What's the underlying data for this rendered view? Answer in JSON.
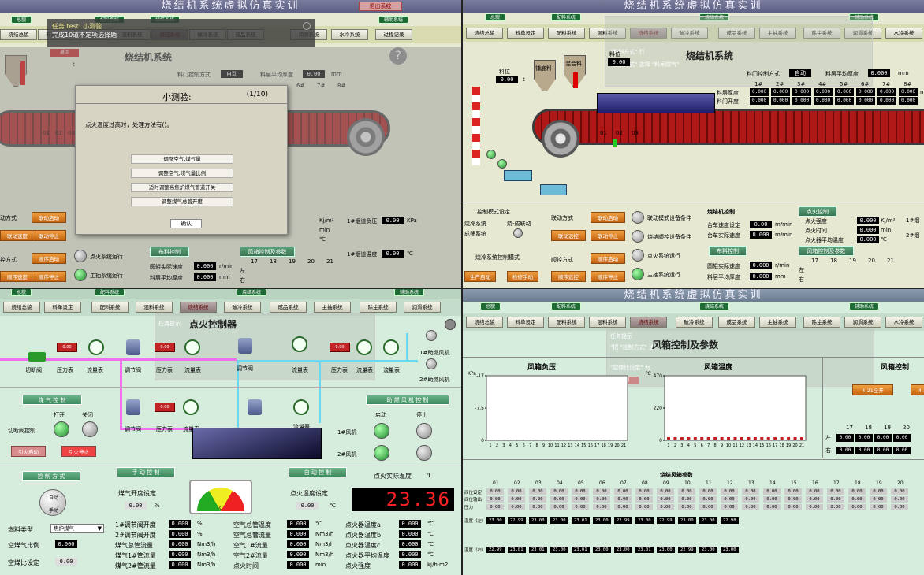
{
  "app_title": "烧结机系统虚拟仿真实训",
  "groups": {
    "total": "总貌",
    "batching": "配料系统",
    "sinter": "烧结系统",
    "aux": "辅助系统"
  },
  "nav": [
    "烧结总貌",
    "料单设定",
    "配料系统",
    "混料系统",
    "烧结系统",
    "破冷系统",
    "成品系统",
    "主抽系统",
    "除尘系统",
    "润滑系统",
    "水冷系统",
    "过程记录"
  ],
  "nav_q2": [
    "烧结总貌",
    "料单设定",
    "配料系统",
    "混料系统",
    "烧结系统",
    "破冷系统",
    "成品系统",
    "主抽系统",
    "除尘系统",
    "润滑系统",
    "水冷系统"
  ],
  "q1": {
    "exit": "退出系统",
    "task": {
      "line1": "任务 test: 小测验",
      "line2": "完成10道不定项选择题",
      "return": "返回"
    },
    "title": "烧结机系统",
    "ignition_mode": "料门控制方式",
    "mode_val": "自动",
    "thickness_label": "料层平均厚度",
    "thickness_val": "0.00",
    "thickness_unit": "mm",
    "cols": [
      "6#",
      "7#",
      "8#"
    ],
    "rows": [
      "0.00",
      "0.00",
      "0.00"
    ],
    "unit_pct": "%",
    "t_label": "t",
    "modal": {
      "title": "小测验:",
      "progress": "(1/10)",
      "question": "点火温度过高时，处理方法有()。",
      "options": [
        "调整空气,煤气量",
        "调整空气,煤气量比例",
        "适时调整高焦炉煤气管道开关",
        "调整煤气总管开度"
      ],
      "confirm": "确认"
    },
    "lbl_linkmode": "动方式",
    "lbl_manual": "控方式",
    "btn_link_start": "联动启动",
    "btn_link_stop": "联动停止",
    "btn_link_fast": "联动速度",
    "btn_seq_start": "顺序启动",
    "btn_seq_stop": "顺序停止",
    "btn_seq_fast": "顺序速度",
    "ignite_run": "点火系统运行",
    "main_run": "主抽系统运行",
    "cloth": "布料控制",
    "roller_speed": "圆辊实际速度",
    "layer_thick": "料层平均厚度",
    "rpm": "r/min",
    "mm": "mm",
    "fan_ctrl": "风箱控制及参数",
    "fan_cols": [
      "17",
      "18",
      "19",
      "20",
      "21"
    ],
    "left": "左",
    "right": "右",
    "kj": "Kj/m²",
    "min": "min",
    "deg": "℃",
    "smoke1": "1#烟道负压",
    "smoke2": "1#烟道温度",
    "kpa": "KPa",
    "zero": "0.00",
    "zero0": "0.000",
    "num_01": "01",
    "num_02": "02",
    "num_03": "03"
  },
  "q2": {
    "title": "烧结机系统",
    "task": {
      "line1": "料位",
      "line2": "\"整制方式\" 行",
      "line3": "\"组控方式\" 选择 \"料闸煤气\""
    },
    "hopper1": "铺底料",
    "hopper2": "混合料",
    "level": "料位",
    "t": "t",
    "ignite_ctrl": "料门控制方式",
    "auto": "自动",
    "avg_thick": "料层平均厚度",
    "mm": "mm",
    "cols": [
      "1#",
      "2#",
      "3#",
      "4#",
      "5#",
      "6#",
      "7#",
      "8#"
    ],
    "row1_label": "料层厚度",
    "row2_label": "料门开度",
    "zero": "0.000",
    "pct": "%",
    "numbers": [
      "01",
      "02",
      "03"
    ],
    "ctrl_mode_set": "控制模式设定",
    "opt1": "烧冷系统",
    "opt2": "成筛系统",
    "opt3": "烧-成联动",
    "link_mode": "联动方式",
    "seq_mode": "顺控方式",
    "link_cond": "联动模式设备条件",
    "seq_cond": "烧结顺控设备条件",
    "ignite_run": "点火系统运行",
    "main_run": "主抽系统运行",
    "btn_link_start": "联动启动",
    "btn_link_stop": "联动停止",
    "btn_link_fast": "联动远控",
    "btn_seq_start": "顺序启动",
    "btn_seq_stop": "顺序停止",
    "btn_seq_fast": "顺序远控",
    "btn_prod_start": "生产启动",
    "btn_check": "检修手动",
    "sinter_mode": "烧冷系统控制模式",
    "sinter_ctrl": "烧结机控制",
    "trolley_set": "台车速度设定",
    "trolley_act": "台车实际速度",
    "m_min": "m/min",
    "cloth": "布料控制",
    "roller": "圆辊实际速度",
    "avg_layer": "料层平均厚度",
    "r_min": "r/min",
    "ignite_ctrl2": "点火控制",
    "ignite_int": "点火强度",
    "ignite_time": "点火时间",
    "ignite_avg": "点火器平均温度",
    "kj": "Kj/m²",
    "min": "min",
    "deg": "℃",
    "fan_ctrl": "风箱控制及参数",
    "fan_cols": [
      "17",
      "18",
      "19",
      "20",
      "21"
    ],
    "left": "左",
    "right": "右",
    "smoke1": "1#烟",
    "smoke2": "2#烟",
    "z00": "0.00"
  },
  "q3": {
    "title": "点火控制器",
    "task": {
      "line1": "任务提示",
      "line2": "\"把控制方式\" 选",
      "line3": "\"燃料类型\" 选择 \"料闸煤气\"",
      "line4": "出现\"料..\""
    },
    "valve": "切断阀",
    "pressure": "压力表",
    "flow": "流量表",
    "reg": "调节阀",
    "fan1": "1#助燃风机",
    "fan2": "2#助燃风机",
    "gas_ctrl": "煤 气 控 制",
    "aux_fan_ctrl": "助 燃 风 机 控 制",
    "open": "打开",
    "close": "关闭",
    "start": "启动",
    "stop": "停止",
    "cutoff_ctrl": "切断阀控制",
    "fire_start": "引火启动",
    "fire_stop": "引火停止",
    "fan1_lbl": "1#风机",
    "fan2_lbl": "2#风机",
    "ctrl_mode": "控 制 方 式",
    "manual_ctrl": "手 动 控 制",
    "auto_ctrl": "自 动 控 制",
    "knob_a": "自动",
    "knob_m": "手动",
    "gas_open": "煤气开度设定",
    "gas_open_val": "0.00",
    "pct": "%",
    "ignite_temp_set": "点火温度设定",
    "ignite_temp_val": "0.00",
    "deg": "℃",
    "actual_temp": "点火实际温度",
    "led": "23.36",
    "fuel_type": "燃料类型",
    "fuel_val": "焦炉煤气",
    "air_ratio": "空煤气比例",
    "air_ratio_val": "0.000",
    "air_set": "空煤比设定",
    "air_set_val": "0.00",
    "gauge_val": "0",
    "meter_val": "0.00",
    "stats": [
      {
        "k": "1#调节阀开度",
        "v": "0.000",
        "u": "%"
      },
      {
        "k": "2#调节阀开度",
        "v": "0.000",
        "u": "%"
      },
      {
        "k": "煤气总管流量",
        "v": "0.000",
        "u": "Nm3/h"
      },
      {
        "k": "煤气1#管流量",
        "v": "0.000",
        "u": "Nm3/h"
      },
      {
        "k": "煤气2#管流量",
        "v": "0.000",
        "u": "Nm3/h"
      }
    ],
    "stats2": [
      {
        "k": "空气总管温度",
        "v": "0.000",
        "u": "℃"
      },
      {
        "k": "空气总管流量",
        "v": "0.000",
        "u": "Nm3/h"
      },
      {
        "k": "空气1#流量",
        "v": "0.000",
        "u": "Nm3/h"
      },
      {
        "k": "空气2#流量",
        "v": "0.000",
        "u": "Nm3/h"
      },
      {
        "k": "点火时间",
        "v": "0.000",
        "u": "min"
      }
    ],
    "stats3": [
      {
        "k": "点火器温度a",
        "v": "0.000",
        "u": "℃"
      },
      {
        "k": "点火器温度b",
        "v": "0.000",
        "u": "℃"
      },
      {
        "k": "点火器温度c",
        "v": "0.000",
        "u": "℃"
      },
      {
        "k": "点火器平均温度",
        "v": "0.000",
        "u": "℃"
      },
      {
        "k": "点火强度",
        "v": "0.000",
        "u": "kj/h·m2"
      }
    ]
  },
  "q4": {
    "title": "风箱控制及参数",
    "task": {
      "line1": "任务提示",
      "line2": "\"把 \"控制方式\" 选",
      "line3": "\"燃料类型\" 选择 \"料闸煤气\"",
      "line4": "\"空煤比设定\" 为",
      "ret": "返回"
    },
    "chart1": "风箱负压",
    "chart2": "风箱温度",
    "chart3": "风箱控制",
    "btn_open": "4-21全开",
    "btn_close": "4-2",
    "y1": [
      "-17",
      "-7.5",
      "0"
    ],
    "y1unit": "KPa",
    "y2": [
      "470",
      "220",
      "0"
    ],
    "y2unit": "℃",
    "xticks": [
      "1",
      "2",
      "3",
      "4",
      "5",
      "6",
      "7",
      "8",
      "9",
      "10",
      "11",
      "12",
      "13",
      "14",
      "15",
      "16",
      "17",
      "18",
      "19",
      "20",
      "21"
    ],
    "ctrl_cols": [
      "17",
      "18",
      "19",
      "20"
    ],
    "left": "左",
    "right": "右",
    "z": "0.00",
    "param_title": "烧结风箱参数",
    "param_cols": [
      "01",
      "02",
      "03",
      "04",
      "05",
      "06",
      "07",
      "08",
      "09",
      "10",
      "11",
      "12",
      "13",
      "14",
      "15",
      "16",
      "17",
      "18",
      "19",
      "20"
    ],
    "row_labels": [
      "阀位设定",
      "阀位输出",
      "压力",
      "温度（左）",
      "温度（右）"
    ],
    "temp_vals": [
      "23.00",
      "22.99",
      "23.00",
      "23.00",
      "23.01",
      "23.00",
      "22.99",
      "23.00",
      "22.99",
      "23.00",
      "23.00",
      "22.98"
    ],
    "temp2_vals": [
      "22.99",
      "23.01",
      "23.01",
      "23.00",
      "23.01",
      "23.00",
      "23.00",
      "23.01",
      "23.00",
      "22.99",
      "23.00",
      "23.00"
    ]
  }
}
